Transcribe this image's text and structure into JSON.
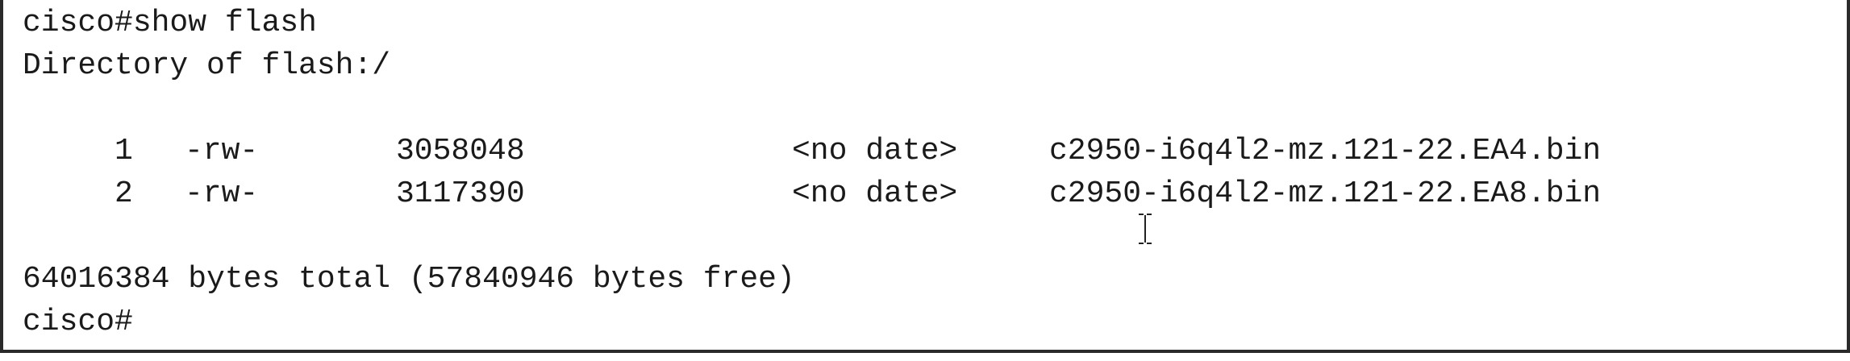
{
  "terminal": {
    "command_line": "cisco#show flash",
    "directory_line": "Directory of flash:/",
    "files": [
      {
        "index": "1",
        "perms": "-rw-",
        "size": "3058048",
        "date": "<no date>",
        "name": "c2950-i6q4l2-mz.121-22.EA4.bin"
      },
      {
        "index": "2",
        "perms": "-rw-",
        "size": "3117390",
        "date": "<no date>",
        "name": "c2950-i6q4l2-mz.121-22.EA8.bin"
      }
    ],
    "summary_line": "64016384 bytes total (57840946 bytes free)",
    "prompt": "cisco#"
  },
  "icons": {
    "mouse_cursor": "text-cursor-ibeam-icon"
  }
}
